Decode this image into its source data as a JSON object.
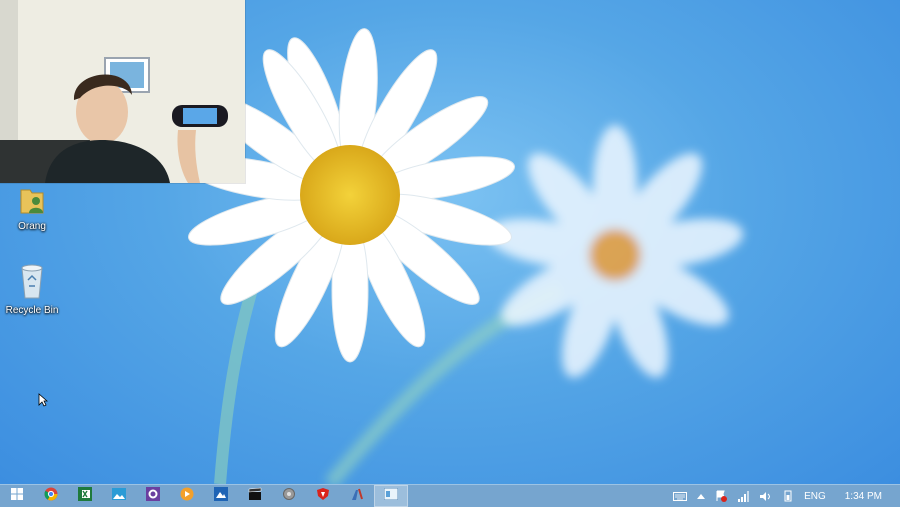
{
  "desktop": {
    "icons": [
      {
        "label": "Orang",
        "icon": "user-folder-icon"
      },
      {
        "label": "Recycle Bin",
        "icon": "recycle-bin-icon"
      }
    ]
  },
  "taskbar": {
    "start_icon": "windows-logo-icon",
    "apps": [
      {
        "name": "chrome",
        "icon": "chrome-icon"
      },
      {
        "name": "excel",
        "icon": "excel-icon"
      },
      {
        "name": "photos",
        "icon": "photos-icon"
      },
      {
        "name": "settings",
        "icon": "purple-gear-icon"
      },
      {
        "name": "media",
        "icon": "media-player-icon"
      },
      {
        "name": "onedrive",
        "icon": "onedrive-icon"
      },
      {
        "name": "clapper",
        "icon": "clapperboard-icon"
      },
      {
        "name": "gear",
        "icon": "gear-icon"
      },
      {
        "name": "shield",
        "icon": "shield-icon"
      },
      {
        "name": "paint",
        "icon": "paint-icon"
      },
      {
        "name": "window",
        "icon": "window-icon"
      }
    ],
    "tray": {
      "language": "ENG",
      "time": "1:34 PM"
    }
  },
  "colors": {
    "taskbar": "#78a5cd",
    "wallpaper": "#55a6e6"
  }
}
